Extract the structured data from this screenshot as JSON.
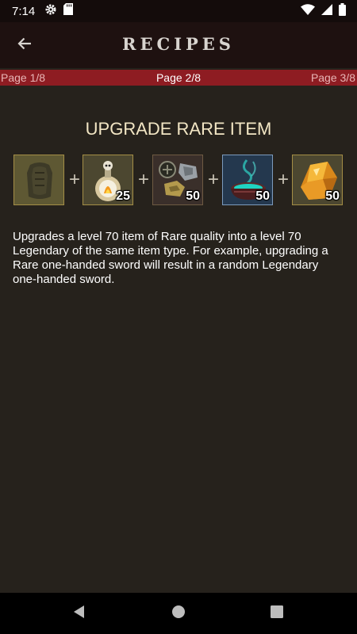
{
  "status_bar": {
    "time": "7:14",
    "icons_left": [
      "gear-icon",
      "sd-card-icon"
    ],
    "icons_right": [
      "wifi-icon",
      "signal-icon",
      "battery-icon"
    ]
  },
  "app_bar": {
    "title": "RECIPES",
    "back_icon": "arrow-left-icon"
  },
  "pager": {
    "prev": "Page 1/8",
    "current": "Page 2/8",
    "next": "Page 3/8"
  },
  "recipe": {
    "title": "UPGRADE RARE ITEM",
    "ingredients": [
      {
        "icon": "rare-chest-armor-icon",
        "count": ""
      },
      {
        "icon": "skull-potion-flask-icon",
        "count": "25"
      },
      {
        "icon": "crafting-materials-icon",
        "count": "50"
      },
      {
        "icon": "glowing-cauldron-icon",
        "count": "50"
      },
      {
        "icon": "amber-crystal-icon",
        "count": "50"
      }
    ],
    "separator": "+",
    "description": "Upgrades a level 70 item of Rare quality into a level 70 Legendary of the same item type. For example, upgrading a Rare one-handed sword will result in a random Legendary one-handed sword."
  },
  "nav_bar": {
    "buttons": [
      "back-triangle-icon",
      "home-circle-icon",
      "recents-square-icon"
    ]
  },
  "colors": {
    "background": "#26221c",
    "pager_bar": "#8e1c22",
    "title_gold": "#f2e6c4",
    "slot_border": "#a48e46"
  }
}
